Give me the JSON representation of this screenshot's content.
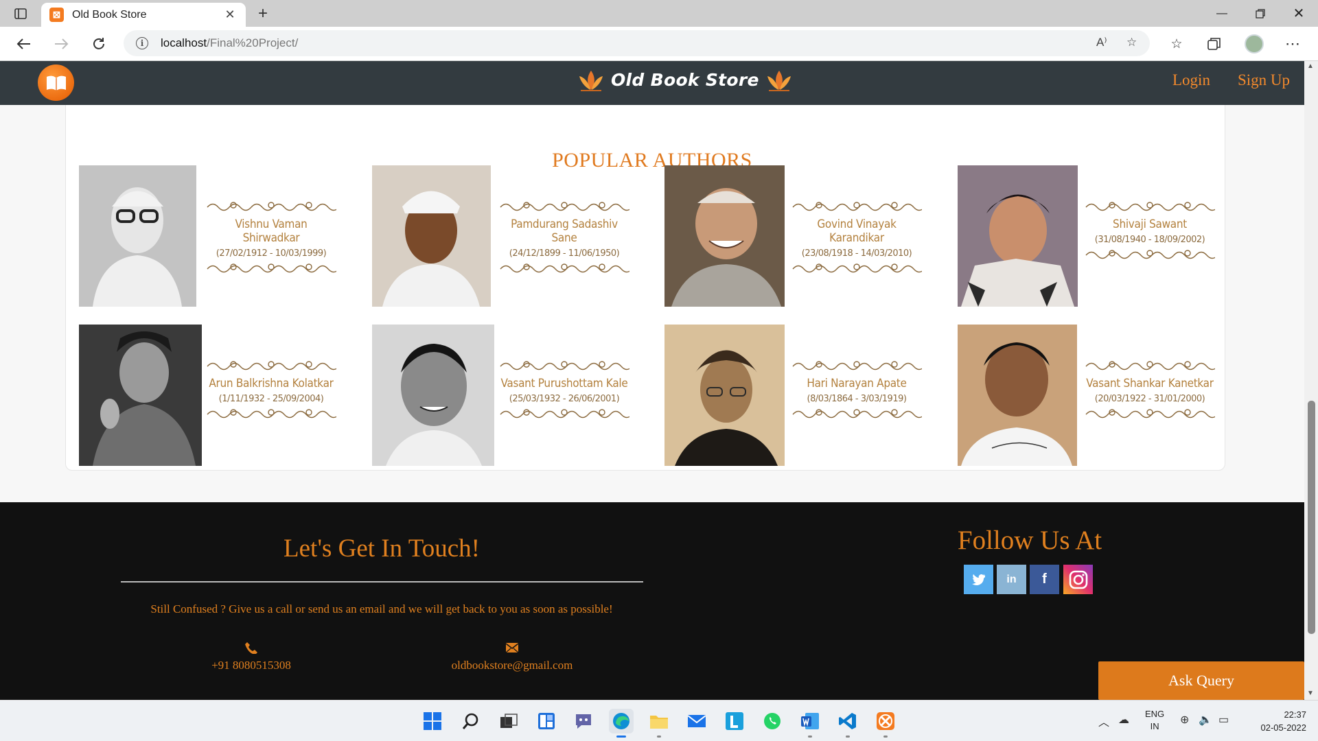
{
  "browser": {
    "tab_title": "Old Book Store",
    "tab_favicon": "xampp-icon",
    "url_host": "localhost",
    "url_path": "/Final%20Project/",
    "read_aloud_label": "A⁾"
  },
  "site": {
    "brand_name": "Old Book Store",
    "login": "Login",
    "signup": "Sign Up"
  },
  "authors": {
    "title": "POPULAR AUTHORS",
    "items": [
      {
        "name": "Vishnu Vaman Shirwadkar",
        "dates": "(27/02/1912 - 10/03/1999)"
      },
      {
        "name": "Pamdurang Sadashiv Sane",
        "dates": "(24/12/1899 - 11/06/1950)"
      },
      {
        "name": "Govind Vinayak Karandikar",
        "dates": "(23/08/1918 - 14/03/2010)"
      },
      {
        "name": "Shivaji Sawant",
        "dates": "(31/08/1940 - 18/09/2002)"
      },
      {
        "name": "Arun Balkrishna Kolatkar",
        "dates": "(1/11/1932 - 25/09/2004)"
      },
      {
        "name": "Vasant Purushottam Kale",
        "dates": "(25/03/1932 - 26/06/2001)"
      },
      {
        "name": "Hari Narayan Apate",
        "dates": "(8/03/1864 - 3/03/1919)"
      },
      {
        "name": "Vasant Shankar Kanetkar",
        "dates": "(20/03/1922 - 31/01/2000)"
      }
    ]
  },
  "footer": {
    "touch_title": "Let's Get In Touch!",
    "touch_text": "Still Confused ? Give us a call or send us an email and we will get back to you as soon as possible!",
    "phone": "+91 8080515308",
    "email": "oldbookstore@gmail.com",
    "follow_title": "Follow Us At",
    "social": [
      {
        "name": "twitter",
        "glyph": "t",
        "color": "#55acee"
      },
      {
        "name": "linkedin",
        "glyph": "in",
        "color": "#8ab4d4"
      },
      {
        "name": "facebook",
        "glyph": "f",
        "color": "#3b5998"
      },
      {
        "name": "instagram",
        "glyph": "",
        "color": "#e1306c"
      }
    ]
  },
  "ask_query": "Ask Query",
  "taskbar": {
    "lang_top": "ENG",
    "lang_bottom": "IN",
    "time": "22:37",
    "date": "02-05-2022"
  },
  "colors": {
    "accent": "#e07a1f",
    "header_bg": "#333b40",
    "footer_bg": "#111111"
  }
}
